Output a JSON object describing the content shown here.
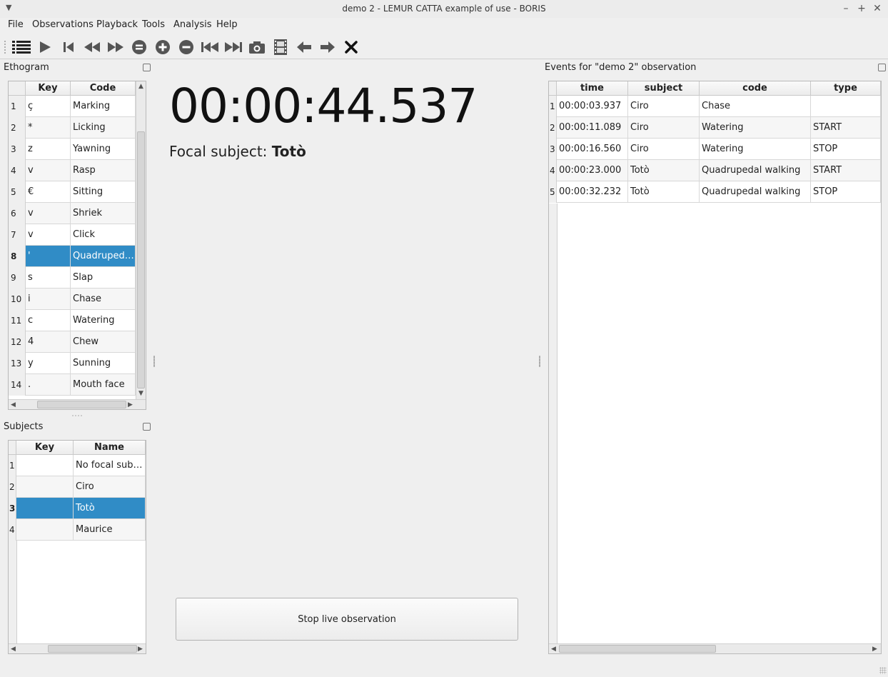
{
  "window": {
    "title": "demo 2 - LEMUR CATTA example of use - BORIS"
  },
  "menu": [
    "File",
    "Observations",
    "Playback",
    "Tools",
    "Analysis",
    "Help"
  ],
  "toolbar_icons": [
    "list-icon",
    "play-icon",
    "skip-start-icon",
    "rewind-icon",
    "fast-forward-icon",
    "equal-speed-icon",
    "speed-up-icon",
    "slow-down-icon",
    "previous-media-icon",
    "next-media-icon",
    "snapshot-icon",
    "frame-by-frame-icon",
    "jump-backward-icon",
    "jump-forward-icon",
    "close-observation-icon"
  ],
  "ethogram": {
    "title": "Ethogram",
    "headers": [
      "Key",
      "Code"
    ],
    "rows": [
      {
        "n": "1",
        "key": "ç",
        "code": "Marking"
      },
      {
        "n": "2",
        "key": "*",
        "code": "Licking"
      },
      {
        "n": "3",
        "key": "z",
        "code": "Yawning"
      },
      {
        "n": "4",
        "key": "v",
        "code": "Rasp"
      },
      {
        "n": "5",
        "key": "€",
        "code": "Sitting"
      },
      {
        "n": "6",
        "key": "v",
        "code": "Shriek"
      },
      {
        "n": "7",
        "key": "v",
        "code": "Click"
      },
      {
        "n": "8",
        "key": "'",
        "code": "Quadrupedal walking"
      },
      {
        "n": "9",
        "key": "s",
        "code": "Slap"
      },
      {
        "n": "10",
        "key": "i",
        "code": "Chase"
      },
      {
        "n": "11",
        "key": "c",
        "code": "Watering"
      },
      {
        "n": "12",
        "key": "4",
        "code": "Chew"
      },
      {
        "n": "13",
        "key": "y",
        "code": "Sunning"
      },
      {
        "n": "14",
        "key": ".",
        "code": "Mouth face"
      }
    ],
    "selected_row": 8
  },
  "subjects": {
    "title": "Subjects",
    "headers": [
      "Key",
      "Name"
    ],
    "rows": [
      {
        "n": "1",
        "key": "",
        "name": "No focal subject"
      },
      {
        "n": "2",
        "key": "",
        "name": "Ciro"
      },
      {
        "n": "3",
        "key": "",
        "name": "Totò"
      },
      {
        "n": "4",
        "key": "",
        "name": "Maurice"
      }
    ],
    "selected_row": 3
  },
  "center": {
    "timer": "00:00:44.537",
    "focal_label": "Focal subject:",
    "focal_value": "Totò",
    "stop_button": "Stop live observation"
  },
  "events": {
    "title": "Events for \"demo 2\" observation",
    "headers": [
      "time",
      "subject",
      "code",
      "type"
    ],
    "rows": [
      {
        "n": "1",
        "time": "00:00:03.937",
        "subject": "Ciro",
        "code": "Chase",
        "type": ""
      },
      {
        "n": "2",
        "time": "00:00:11.089",
        "subject": "Ciro",
        "code": "Watering",
        "type": "START"
      },
      {
        "n": "3",
        "time": "00:00:16.560",
        "subject": "Ciro",
        "code": "Watering",
        "type": "STOP"
      },
      {
        "n": "4",
        "time": "00:00:23.000",
        "subject": "Totò",
        "code": "Quadrupedal walking",
        "type": "START"
      },
      {
        "n": "5",
        "time": "00:00:32.232",
        "subject": "Totò",
        "code": "Quadrupedal walking",
        "type": "STOP"
      }
    ]
  },
  "colors": {
    "selection": "#308cc6",
    "background": "#efefef"
  }
}
